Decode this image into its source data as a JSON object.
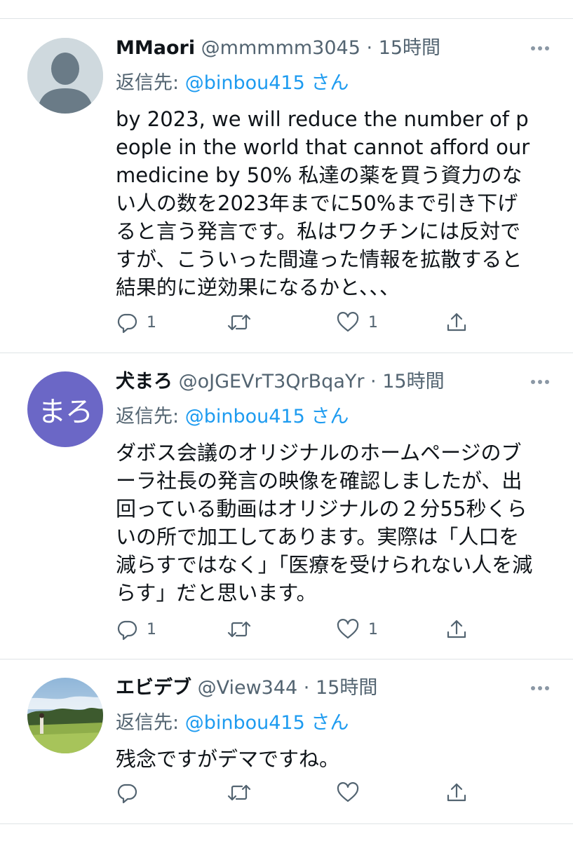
{
  "tweets": [
    {
      "name": "MMaori",
      "handle": "@mmmmm3045",
      "dot": "·",
      "time": "15時間",
      "reply_prefix": "返信先: ",
      "reply_target": "@binbou415 さん",
      "body": "by 2023, we will reduce the number of people in the world that cannot afford our medicine by 50% 私達の薬を買う資力のない人の数を2023年までに50%まで引き下げると言う発言です。私はワクチンには反対ですが、こういった間違った情報を拡散すると結果的に逆効果になるかと、、、",
      "reply_count": "1",
      "retweet_count": "",
      "like_count": "1",
      "avatar_icon": "default-profile-icon"
    },
    {
      "name": "犬まろ",
      "handle": "@oJGEVrT3QrBqaYr",
      "dot": "·",
      "time": "15時間",
      "reply_prefix": "返信先: ",
      "reply_target": "@binbou415 さん",
      "body": "ダボス会議のオリジナルのホームページのブーラ社長の発言の映像を確認しましたが、出回っている動画はオリジナルの２分55秒くらいの所で加工してあります。実際は「人口を減らすではなく」「医療を受けられない人を減らす」だと思います。",
      "reply_count": "1",
      "retweet_count": "",
      "like_count": "1",
      "avatar_text": "まろ"
    },
    {
      "name": "エビデブ",
      "handle": "@View344",
      "dot": "·",
      "time": "15時間",
      "reply_prefix": "返信先: ",
      "reply_target": "@binbou415 さん",
      "body": "残念ですがデマですね。",
      "reply_count": "",
      "retweet_count": "",
      "like_count": "",
      "avatar_icon": "golf-photo"
    }
  ],
  "colors": {
    "text": "#0f1419",
    "secondary": "#536471",
    "link": "#1d9bf0",
    "divider": "#dfe3e6",
    "avatar_purple": "#6b67c6",
    "avatar_default": "#cfd9de"
  }
}
